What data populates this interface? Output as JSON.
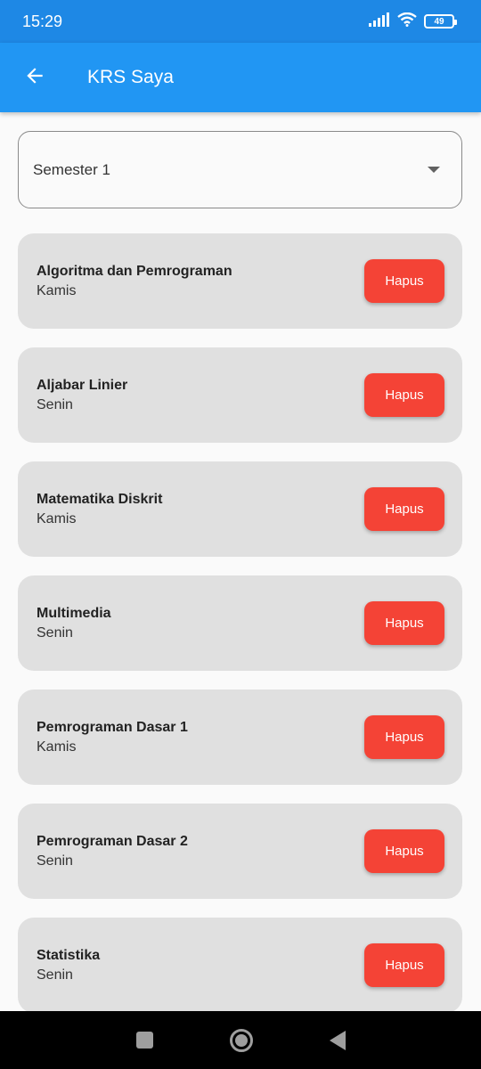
{
  "status_bar": {
    "time": "15:29",
    "battery_level": "49",
    "icons": [
      "signal-icon",
      "wifi-icon",
      "battery-icon"
    ]
  },
  "app_bar": {
    "title": "KRS Saya",
    "back_icon": "arrow-back-icon",
    "background_color": "#2196f3"
  },
  "semester_select": {
    "value": "Semester 1",
    "icon": "dropdown-caret-icon"
  },
  "courses": [
    {
      "name": "Algoritma dan Pemrograman",
      "day": "Kamis",
      "action": "Hapus"
    },
    {
      "name": "Aljabar Linier",
      "day": "Senin",
      "action": "Hapus"
    },
    {
      "name": "Matematika Diskrit",
      "day": "Kamis",
      "action": "Hapus"
    },
    {
      "name": "Multimedia",
      "day": "Senin",
      "action": "Hapus"
    },
    {
      "name": "Pemrograman Dasar 1",
      "day": "Kamis",
      "action": "Hapus"
    },
    {
      "name": "Pemrograman Dasar 2",
      "day": "Senin",
      "action": "Hapus"
    },
    {
      "name": "Statistika",
      "day": "Senin",
      "action": "Hapus"
    }
  ],
  "colors": {
    "card": "#e0e0e0",
    "delete_button": "#f44336"
  },
  "nav_bar": {
    "icons": [
      "recent-apps-icon",
      "home-icon",
      "back-triangle-icon"
    ]
  }
}
